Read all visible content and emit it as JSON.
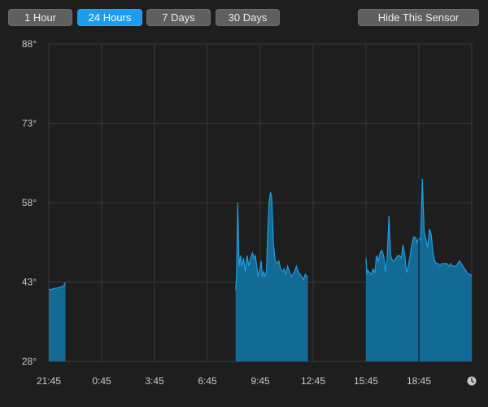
{
  "toolbar": {
    "range_buttons": [
      {
        "label": "1 Hour",
        "active": false
      },
      {
        "label": "24 Hours",
        "active": true
      },
      {
        "label": "7 Days",
        "active": false
      },
      {
        "label": "30 Days",
        "active": false
      }
    ],
    "hide_label": "Hide This Sensor"
  },
  "icons": {
    "clock": "clock-icon"
  },
  "colors": {
    "background": "#1e1e1e",
    "accent": "#1a9df0",
    "area_fill": "#126a95",
    "area_line": "#1f9ee0",
    "grid": "#3a3a3a",
    "axis_text": "#c8c8c8"
  },
  "chart_data": {
    "type": "area",
    "title": "",
    "xlabel": "",
    "ylabel": "",
    "ylim": [
      28,
      88
    ],
    "yticks": [
      "88°",
      "73°",
      "58°",
      "43°",
      "28°"
    ],
    "ytick_values": [
      88,
      73,
      58,
      43,
      28
    ],
    "xticks": [
      "21:45",
      "0:45",
      "3:45",
      "6:45",
      "9:45",
      "12:45",
      "15:45",
      "18:45"
    ],
    "xtick_hours": [
      0,
      3,
      6,
      9,
      12,
      15,
      18,
      21
    ],
    "x_unit": "hours after 21:45",
    "grid": true,
    "series": [
      {
        "segments": [
          {
            "x": [
              0.0,
              0.15,
              0.3,
              0.5,
              0.7,
              0.85,
              0.92,
              0.95
            ],
            "y": [
              41.6,
              41.6,
              41.8,
              41.9,
              42.1,
              42.3,
              42.8,
              42.9
            ]
          },
          {
            "x": [
              10.6,
              10.65,
              10.72,
              10.8,
              10.88,
              10.95,
              11.05,
              11.15,
              11.25,
              11.35,
              11.45,
              11.55,
              11.65,
              11.72,
              11.8,
              11.88,
              11.95,
              12.05,
              12.12,
              12.2,
              12.28,
              12.35,
              12.42,
              12.5,
              12.58,
              12.65,
              12.75,
              12.85,
              12.95,
              13.05,
              13.15,
              13.25,
              13.35,
              13.45,
              13.55,
              13.65,
              13.75,
              13.85,
              13.95,
              14.05,
              14.15,
              14.25,
              14.35,
              14.45,
              14.55,
              14.65,
              14.7
            ],
            "y": [
              41.5,
              44,
              58,
              46,
              48,
              46,
              47.5,
              45,
              48,
              46,
              47.5,
              48.5,
              47.5,
              48,
              46,
              44,
              45,
              47,
              44,
              45,
              44,
              45,
              52,
              58,
              60,
              59,
              50,
              47,
              46.5,
              47,
              45.5,
              45,
              45.5,
              44.5,
              46,
              45,
              44,
              44.5,
              45,
              46,
              45,
              44.5,
              44,
              43.5,
              44.5,
              44,
              44
            ]
          },
          {
            "x": [
              18.0,
              18.05,
              18.1,
              18.2,
              18.3,
              18.4,
              18.5,
              18.6,
              18.7,
              18.8,
              18.9,
              19.0,
              19.1,
              19.2,
              19.3,
              19.4,
              19.5,
              19.6,
              19.7,
              19.8,
              19.9,
              20.0,
              20.1,
              20.2,
              20.3,
              20.4,
              20.5,
              20.6,
              20.7,
              20.8,
              20.9,
              21.0,
              21.1,
              21.2,
              21.3,
              21.4,
              21.5,
              21.6,
              21.7,
              21.8,
              21.9,
              22.0,
              22.1,
              22.2,
              22.3,
              22.4,
              22.5,
              22.6,
              22.7,
              22.8,
              22.9,
              23.0,
              23.1,
              23.2,
              23.3,
              23.4,
              23.5,
              23.6,
              23.7,
              23.8,
              23.9,
              24.0
            ],
            "y": [
              47.5,
              44.5,
              45.2,
              44.8,
              44.5,
              45.5,
              44.7,
              48,
              47,
              48.5,
              49,
              48,
              45,
              47.5,
              55.5,
              48,
              47,
              47,
              47.5,
              48,
              48,
              47.5,
              50,
              48,
              44.8,
              46,
              48,
              50,
              51.5,
              51.5,
              50.5,
              51.5,
              51,
              62.5,
              52.5,
              51,
              49.5,
              53,
              52,
              48.5,
              47,
              46.5,
              46.5,
              46,
              46.5,
              46.5,
              46.5,
              46.5,
              46,
              46.5,
              46,
              46,
              46,
              46.5,
              47,
              46.5,
              46,
              45.5,
              45,
              44.5,
              44.5,
              44.2
            ]
          }
        ]
      }
    ],
    "marker_hour": 21.0
  }
}
